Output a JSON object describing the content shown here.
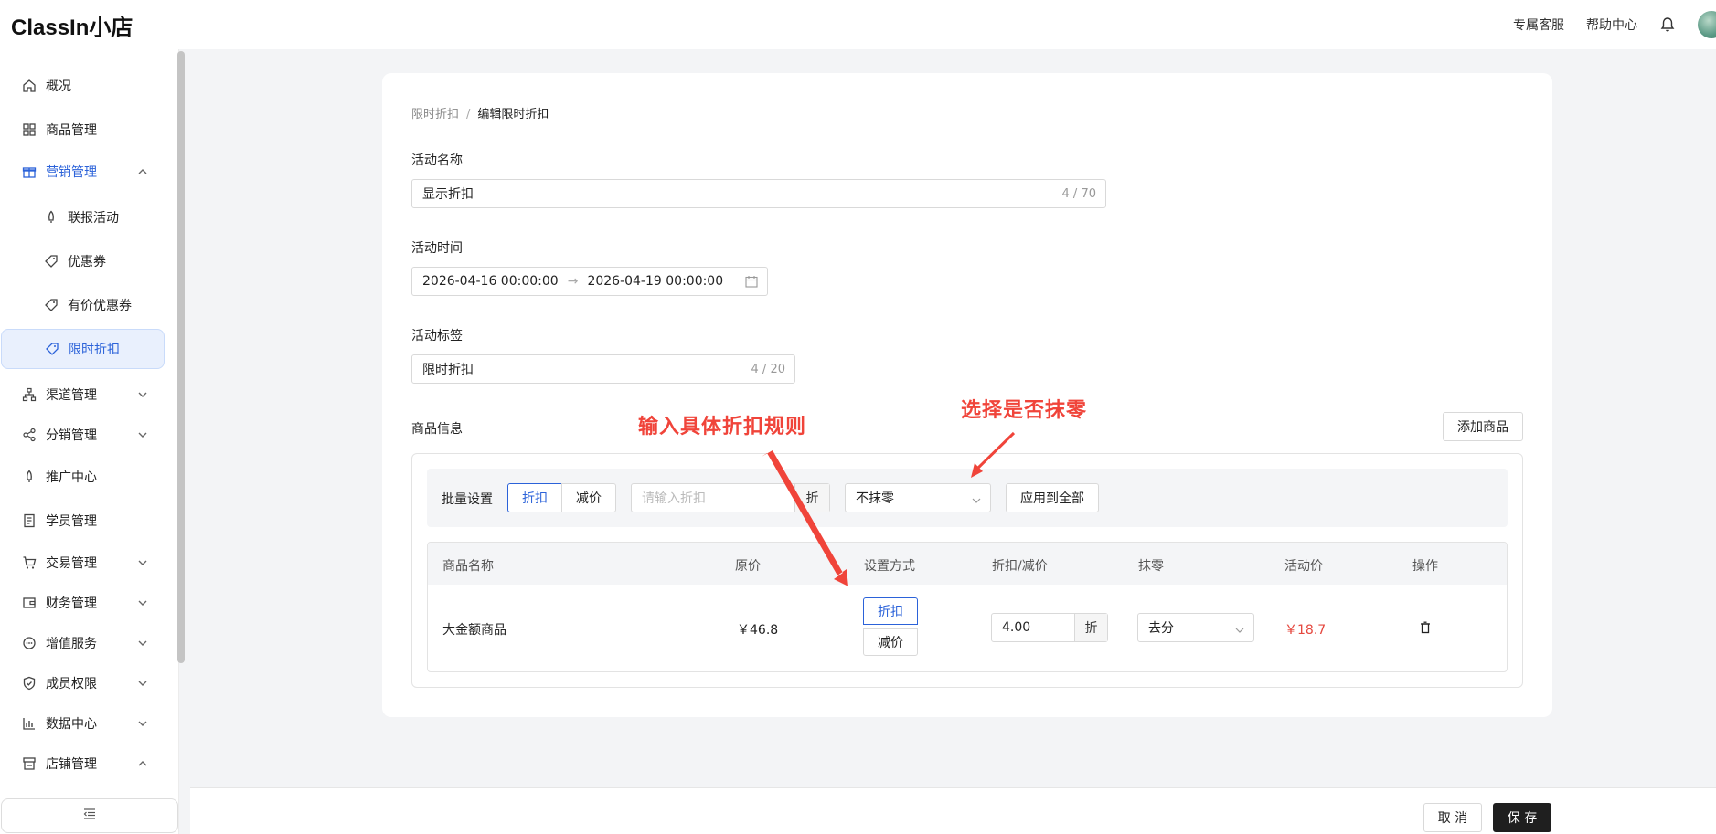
{
  "header": {
    "logo": "ClassIn小店",
    "links": [
      "专属客服",
      "帮助中心"
    ]
  },
  "sidebar": {
    "items": [
      {
        "label": "概况"
      },
      {
        "label": "商品管理"
      },
      {
        "label": "营销管理"
      },
      {
        "label": "联报活动"
      },
      {
        "label": "优惠券"
      },
      {
        "label": "有价优惠券"
      },
      {
        "label": "限时折扣"
      },
      {
        "label": "渠道管理"
      },
      {
        "label": "分销管理"
      },
      {
        "label": "推广中心"
      },
      {
        "label": "学员管理"
      },
      {
        "label": "交易管理"
      },
      {
        "label": "财务管理"
      },
      {
        "label": "增值服务"
      },
      {
        "label": "成员权限"
      },
      {
        "label": "数据中心"
      },
      {
        "label": "店铺管理"
      }
    ]
  },
  "breadcrumb": {
    "parent": "限时折扣",
    "separator": "/",
    "current": "编辑限时折扣"
  },
  "form": {
    "name_label": "活动名称",
    "name_value": "显示折扣",
    "name_count": "4 / 70",
    "time_label": "活动时间",
    "time_start": "2026-04-16 00:00:00",
    "time_arrow": "→",
    "time_end": "2026-04-19 00:00:00",
    "tag_label": "活动标签",
    "tag_value": "限时折扣",
    "tag_count": "4 / 20"
  },
  "products": {
    "section_label": "商品信息",
    "add_button": "添加商品",
    "annotation_left": "输入具体折扣规则",
    "annotation_right": "选择是否抹零",
    "batch": {
      "label": "批量设置",
      "mode_discount": "折扣",
      "mode_reduce": "减价",
      "input_placeholder": "请输入折扣",
      "input_suffix": "折",
      "rounding_value": "不抹零",
      "apply_all": "应用到全部"
    },
    "columns": [
      "商品名称",
      "原价",
      "设置方式",
      "折扣/减价",
      "抹零",
      "活动价",
      "操作"
    ],
    "rows": [
      {
        "name": "大金额商品",
        "original_price": "￥46.8",
        "mode_discount": "折扣",
        "mode_reduce": "减价",
        "value": "4.00",
        "suffix": "折",
        "rounding": "去分",
        "activity_price": "￥18.7"
      }
    ]
  },
  "footer": {
    "cancel": "取 消",
    "save": "保 存"
  },
  "colors": {
    "accent": "#2b62d9",
    "annotation": "#f0443a",
    "price": "#e5483f"
  }
}
